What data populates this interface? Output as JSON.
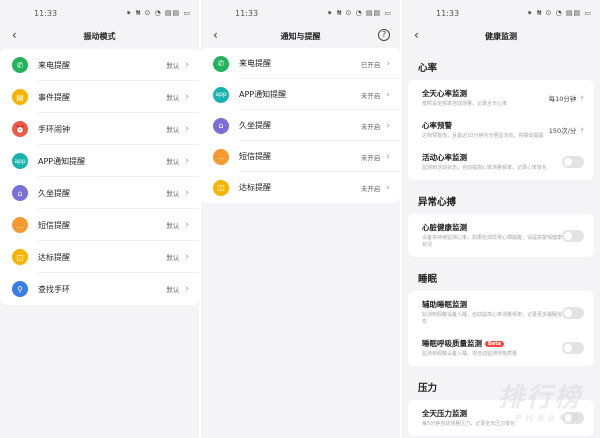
{
  "colors": {
    "green": "#23b35c",
    "yellow": "#f7b500",
    "red": "#ef5a45",
    "teal": "#18b3b0",
    "purple": "#7a6fd7",
    "orange": "#f59a2f",
    "blue": "#3a7ce8"
  },
  "statusbar": {
    "time": "11:33",
    "icons": "⁕ ₦ ⊙ ◔ ▤▤ ▭"
  },
  "panel1": {
    "title": "振动模式",
    "items": [
      {
        "label": "来电提醒",
        "value": "默认",
        "icon": "phone-icon",
        "glyph": "✆",
        "color": "#23b35c"
      },
      {
        "label": "事件提醒",
        "value": "默认",
        "icon": "calendar-icon",
        "glyph": "▤",
        "color": "#f7b500"
      },
      {
        "label": "手环闹钟",
        "value": "默认",
        "icon": "alarm-icon",
        "glyph": "⏰",
        "color": "#ef5a45"
      },
      {
        "label": "APP通知提醒",
        "value": "默认",
        "icon": "app-icon",
        "glyph": "app",
        "color": "#18b3b0"
      },
      {
        "label": "久坐提醒",
        "value": "默认",
        "icon": "sofa-icon",
        "glyph": "⌂",
        "color": "#7a6fd7"
      },
      {
        "label": "短信提醒",
        "value": "默认",
        "icon": "message-icon",
        "glyph": "…",
        "color": "#f59a2f"
      },
      {
        "label": "达标提醒",
        "value": "默认",
        "icon": "goal-icon",
        "glyph": "◫",
        "color": "#f7b500"
      },
      {
        "label": "查找手环",
        "value": "默认",
        "icon": "search-icon",
        "glyph": "⚲",
        "color": "#3a7ce8"
      }
    ]
  },
  "panel2": {
    "title": "通知与提醒",
    "help": "?",
    "items": [
      {
        "label": "来电提醒",
        "value": "已开启",
        "icon": "phone-icon",
        "glyph": "✆",
        "color": "#23b35c"
      },
      {
        "label": "APP通知提醒",
        "value": "未开启",
        "icon": "app-icon",
        "glyph": "app",
        "color": "#18b3b0"
      },
      {
        "label": "久坐提醒",
        "value": "未开启",
        "icon": "sofa-icon",
        "glyph": "⌂",
        "color": "#7a6fd7"
      },
      {
        "label": "短信提醒",
        "value": "未开启",
        "icon": "message-icon",
        "glyph": "…",
        "color": "#f59a2f"
      },
      {
        "label": "达标提醒",
        "value": "未开启",
        "icon": "goal-icon",
        "glyph": "◫",
        "color": "#f7b500"
      }
    ]
  },
  "panel3": {
    "title": "健康监测",
    "sections": {
      "heart": "心率",
      "abnormal": "异常心搏",
      "sleep": "睡眠",
      "stress": "压力"
    },
    "heart_all_day": {
      "title": "全天心率监测",
      "desc": "按照设定频率自动测量，记录全天心率",
      "value": "每10分钟"
    },
    "heart_alert": {
      "title": "心率预警",
      "desc": "达到预警值，且最近10分钟内无明显活动，将振动提醒",
      "value": "150次/分"
    },
    "heart_activity": {
      "title": "活动心率监测",
      "desc": "监测到活动状态，自动提高心率测量频率，记录心率变化"
    },
    "heart_health": {
      "title": "心脏健康监测",
      "desc": "设备将持续监测心率，如果检测异常心搏提醒，请提高警惕健康状况"
    },
    "sleep_assist": {
      "title": "辅助睡眠监测",
      "desc": "监测到佩戴设备入睡，自动提高心率测量频率，记录更多睡眠信息"
    },
    "sleep_breath": {
      "title": "睡眠呼吸质量监测",
      "badge": "Beta",
      "desc": "监测到佩戴设备入睡，将自动监测呼吸质量"
    },
    "stress_all_day": {
      "title": "全天压力监测",
      "desc": "每5分钟自动测量压力，记录全天压力变化"
    }
  },
  "watermark": {
    "main": "排行榜",
    "sub": "PHBANG"
  }
}
